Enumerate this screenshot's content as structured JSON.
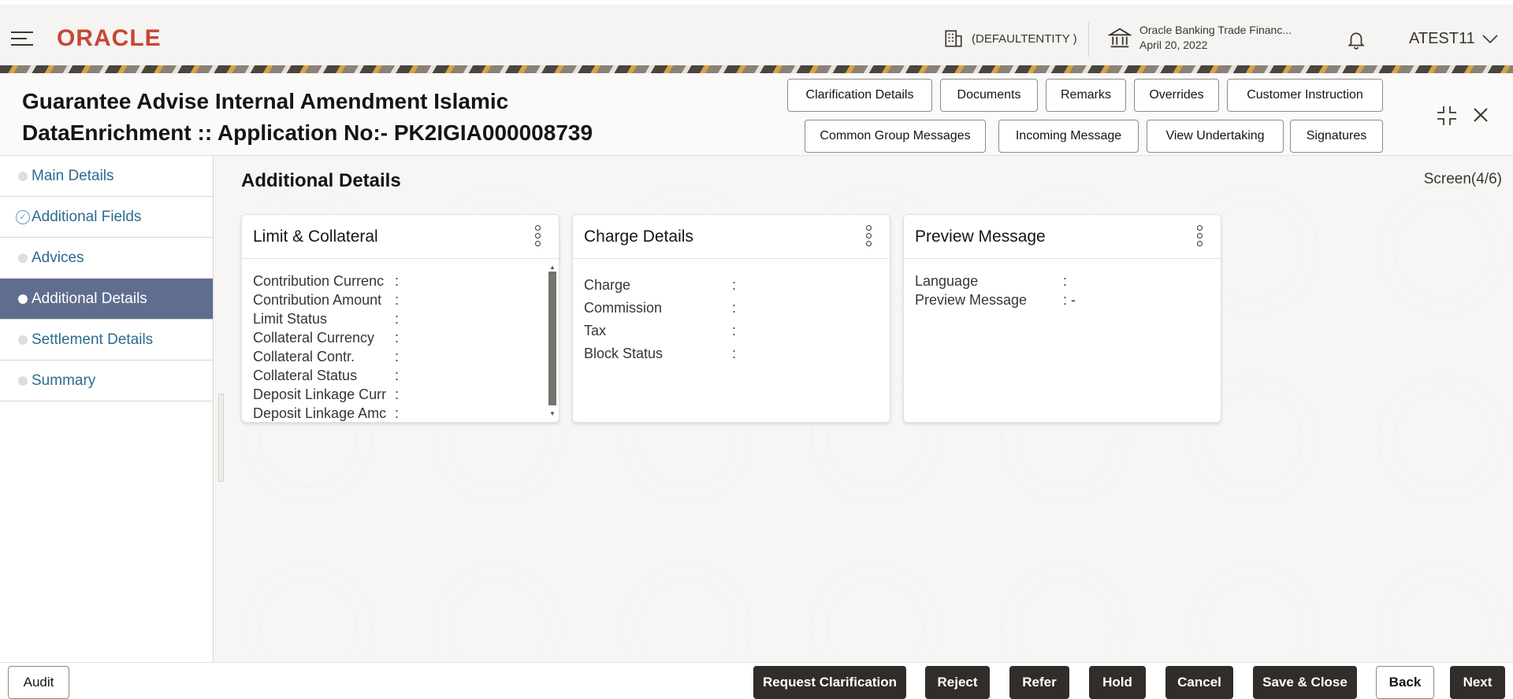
{
  "topbar": {
    "logo": "ORACLE",
    "entity": "(DEFAULTENTITY )",
    "bank_name": "Oracle Banking Trade Financ...",
    "bank_date": "April 20, 2022",
    "user": "ATEST11"
  },
  "header": {
    "title_line1": "Guarantee Advise Internal Amendment Islamic",
    "title_line2": "DataEnrichment :: Application No:- PK2IGIA000008739",
    "buttons_row1": [
      "Clarification Details",
      "Documents",
      "Remarks",
      "Overrides",
      "Customer Instruction"
    ],
    "buttons_row2": [
      "Common Group Messages",
      "Incoming Message",
      "View Undertaking",
      "Signatures"
    ]
  },
  "sidebar": {
    "items": [
      {
        "label": "Main Details",
        "state": "pending"
      },
      {
        "label": "Additional Fields",
        "state": "done"
      },
      {
        "label": "Advices",
        "state": "pending"
      },
      {
        "label": "Additional Details",
        "state": "active"
      },
      {
        "label": "Settlement Details",
        "state": "pending"
      },
      {
        "label": "Summary",
        "state": "pending"
      }
    ]
  },
  "main": {
    "section_title": "Additional Details",
    "screen": "Screen(4/6)",
    "cards": [
      {
        "title": "Limit & Collateral",
        "rows": [
          {
            "label": "Contribution Currenc",
            "value": ":"
          },
          {
            "label": "Contribution Amount",
            "value": ":"
          },
          {
            "label": "Limit Status",
            "value": ":"
          },
          {
            "label": "Collateral Currency",
            "value": ":"
          },
          {
            "label": "Collateral Contr.",
            "value": ":"
          },
          {
            "label": "Collateral Status",
            "value": ":"
          },
          {
            "label": "Deposit Linkage Curr",
            "value": ":"
          },
          {
            "label": "Deposit Linkage Amc",
            "value": ":"
          }
        ]
      },
      {
        "title": "Charge Details",
        "rows": [
          {
            "label": "Charge",
            "value": ":"
          },
          {
            "label": "Commission",
            "value": ":"
          },
          {
            "label": "Tax",
            "value": ":"
          },
          {
            "label": "Block Status",
            "value": ":"
          }
        ]
      },
      {
        "title": "Preview Message",
        "rows": [
          {
            "label": "Language",
            "value": ":"
          },
          {
            "label": "Preview Message",
            "value": ": -"
          }
        ]
      }
    ]
  },
  "footer": {
    "audit": "Audit",
    "actions": [
      "Request Clarification",
      "Reject",
      "Refer",
      "Hold",
      "Cancel",
      "Save & Close",
      "Back",
      "Next"
    ]
  },
  "colors": {
    "brand_red": "#c74634",
    "active_nav": "#5f6e8f",
    "link_blue": "#2b6b8f",
    "dark_button": "#312d2a"
  }
}
